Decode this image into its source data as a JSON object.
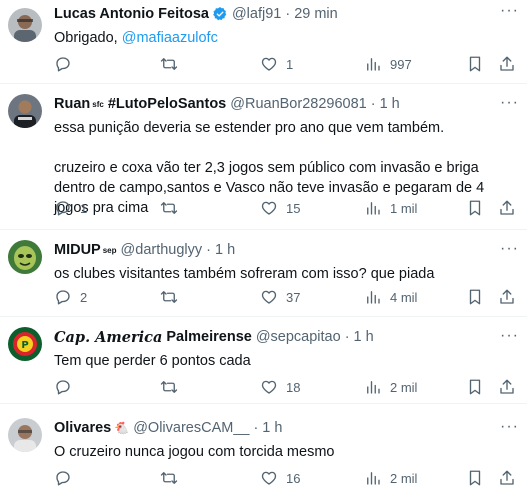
{
  "tweets": [
    {
      "name": "Lucas Antonio Feitosa",
      "handle": "@lafj91",
      "dot": "·",
      "time": "29 min",
      "text": "Obrigado, ",
      "mention": "@mafiaazulofc",
      "replies": "",
      "retweets": "",
      "likes": "1",
      "views": "997"
    },
    {
      "name": "Ruan",
      "name_badge": "sfc",
      "name_suffix": "#LutoPeloSantos",
      "handle": "@RuanBor28296081",
      "dot": "·",
      "time": "1 h",
      "text": "essa punição deveria se estender pro ano que vem também.\n\ncruzeiro e coxa vão ter 2,3 jogos sem público com invasão e briga dentro de campo,santos e Vasco não teve invasão e pegaram de 4 jogos pra cima",
      "replies": "1",
      "retweets": "",
      "likes": "15",
      "views": "1 mil"
    },
    {
      "name": "MIDUP",
      "name_badge": "sep",
      "handle": "@darthuglyy",
      "dot": "·",
      "time": "1 h",
      "text": "os clubes visitantes também sofreram com isso? que piada",
      "replies": "2",
      "retweets": "",
      "likes": "37",
      "views": "4 mil"
    },
    {
      "name_styled": "Cap. America",
      "name": "Palmeirense",
      "handle": "@sepcapitao",
      "dot": "·",
      "time": "1 h",
      "text": "Tem que perder 6 pontos cada",
      "replies": "",
      "retweets": "",
      "likes": "18",
      "views": "2 mil"
    },
    {
      "name": "Olivares",
      "name_emoji": "🐔",
      "handle": "@OlivaresCAM__",
      "dot": "·",
      "time": "1 h",
      "text": "O cruzeiro nunca jogou com torcida mesmo",
      "replies": "",
      "retweets": "",
      "likes": "16",
      "views": "2 mil"
    }
  ],
  "more_label": "···",
  "colors": {
    "text": "#0f1419",
    "secondary": "#536471",
    "accent": "#1d9bf0",
    "divider": "#eff3f4"
  },
  "icons": [
    "reply-icon",
    "retweet-icon",
    "like-icon",
    "views-icon",
    "bookmark-icon",
    "share-icon",
    "verified-icon",
    "more-icon"
  ]
}
